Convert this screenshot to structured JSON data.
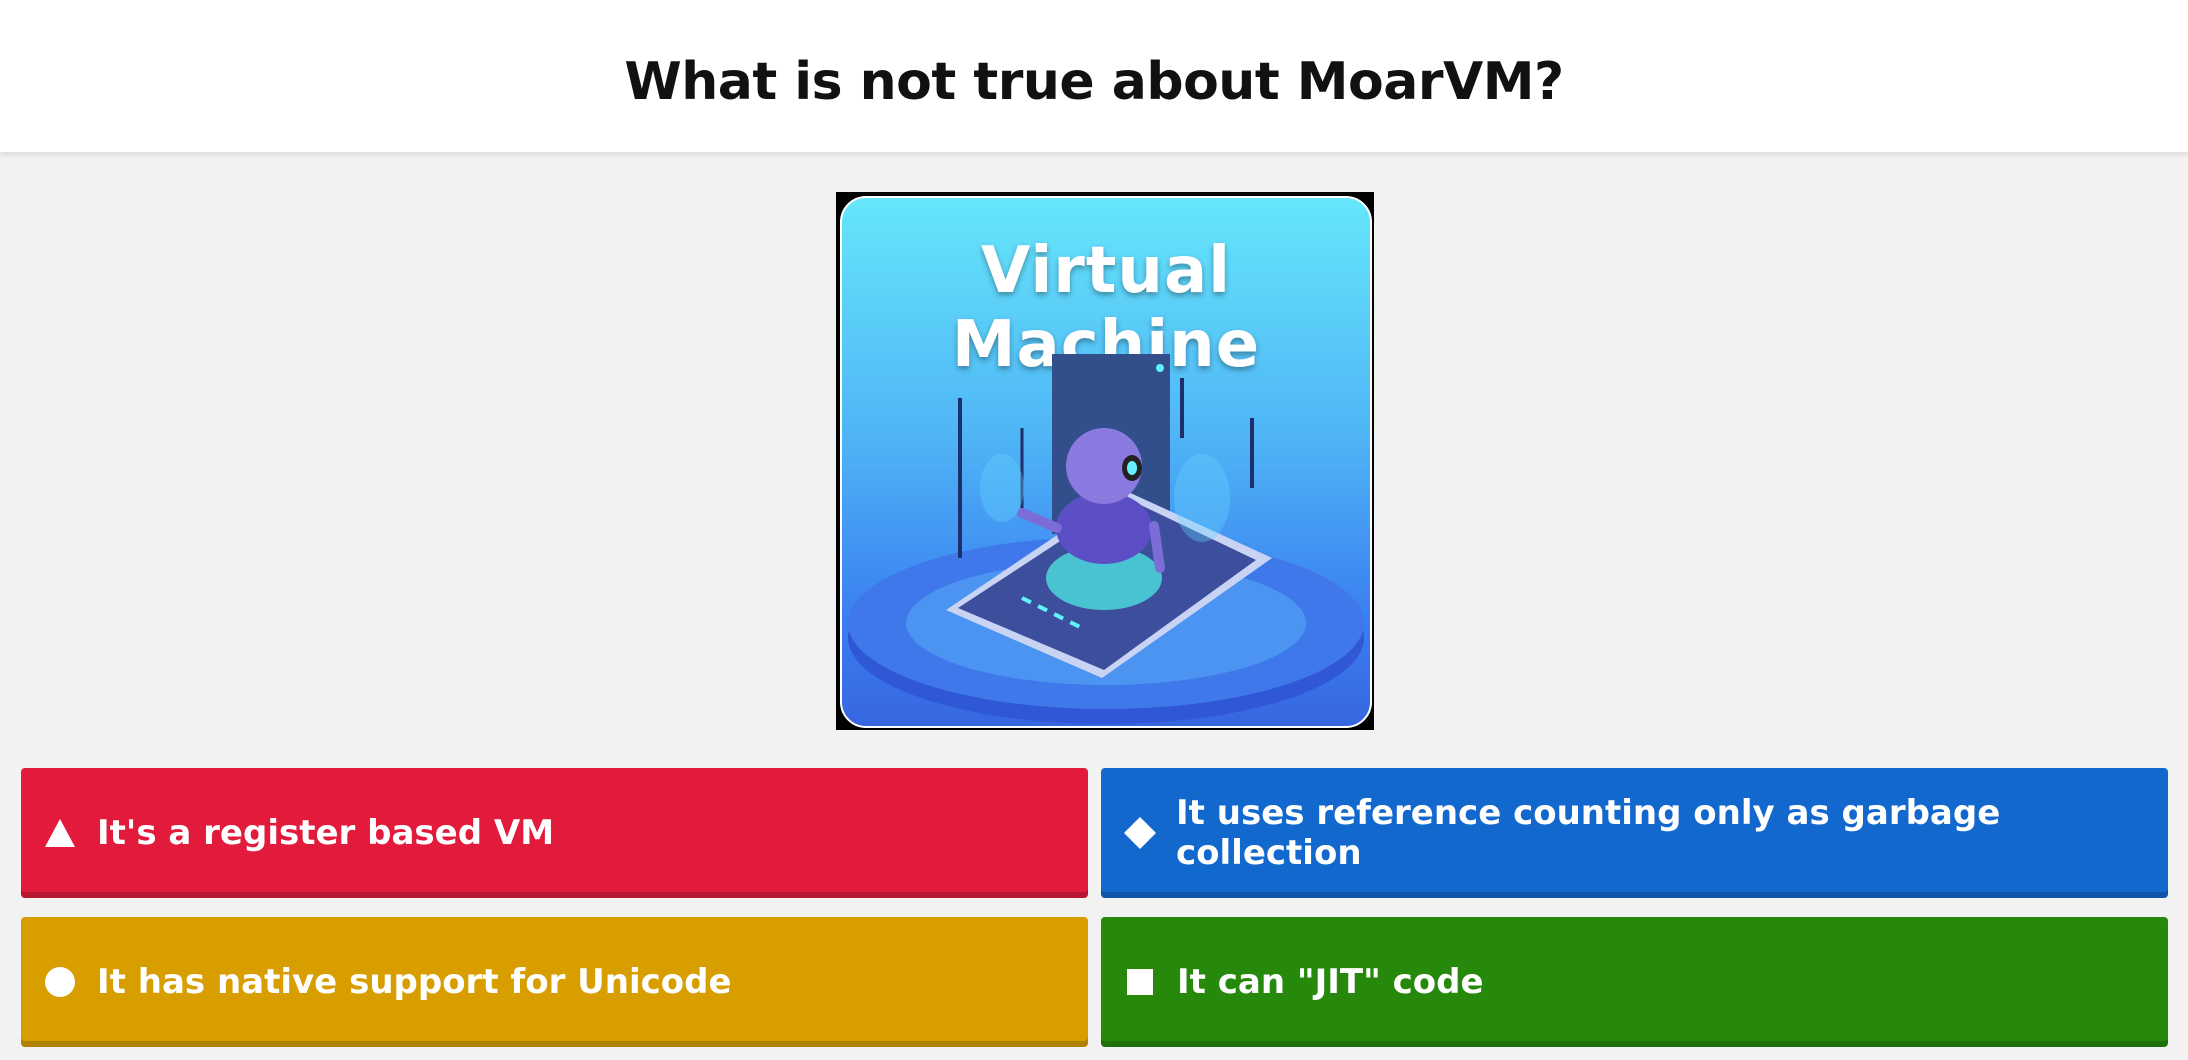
{
  "question": "What is not true about MoarVM?",
  "media": {
    "caption": "Virtual Machine"
  },
  "answers": [
    {
      "shape": "triangle-icon",
      "color": "#e21b3c",
      "label": "It's a register based VM"
    },
    {
      "shape": "diamond-icon",
      "color": "#1368ce",
      "label": "It uses reference counting only as garbage collection"
    },
    {
      "shape": "circle-icon",
      "color": "#d89e00",
      "label": "It has native support for Unicode"
    },
    {
      "shape": "square-icon",
      "color": "#26890c",
      "label": "It can \"JIT\" code"
    }
  ]
}
